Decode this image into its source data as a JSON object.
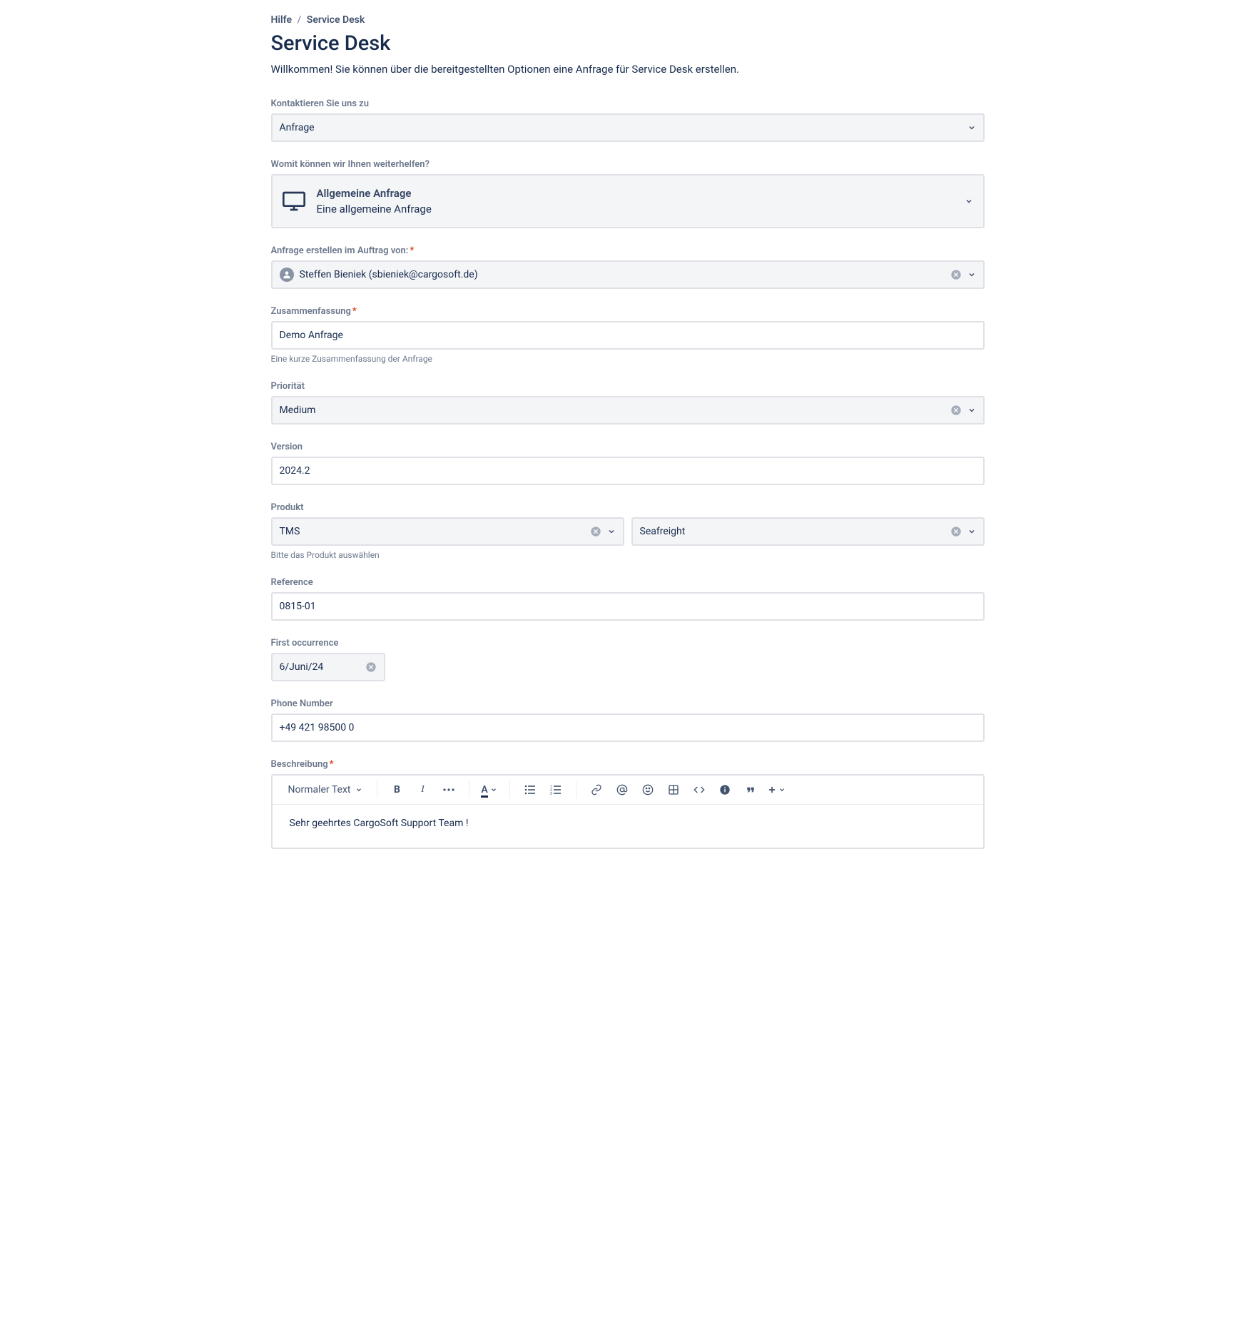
{
  "breadcrumb": {
    "root": "Hilfe",
    "current": "Service Desk"
  },
  "page_title": "Service Desk",
  "welcome": "Willkommen! Sie können über die bereitgestellten Optionen eine Anfrage für Service Desk erstellen.",
  "fields": {
    "contact_about": {
      "label": "Kontaktieren Sie uns zu",
      "value": "Anfrage"
    },
    "help_with": {
      "label": "Womit können wir Ihnen weiterhelfen?",
      "title": "Allgemeine Anfrage",
      "subtitle": "Eine allgemeine Anfrage"
    },
    "on_behalf": {
      "label": "Anfrage erstellen im Auftrag von:",
      "value": "Steffen Bieniek (sbieniek@cargosoft.de)"
    },
    "summary": {
      "label": "Zusammenfassung",
      "value": "Demo Anfrage",
      "help": "Eine kurze Zusammenfassung der Anfrage"
    },
    "priority": {
      "label": "Priorität",
      "value": "Medium"
    },
    "version": {
      "label": "Version",
      "value": "2024.2"
    },
    "product": {
      "label": "Produkt",
      "value1": "TMS",
      "value2": "Seafreight",
      "help": "Bitte das Produkt auswählen"
    },
    "reference": {
      "label": "Reference",
      "value": "0815-01"
    },
    "first_occurrence": {
      "label": "First occurrence",
      "value": "6/Juni/24"
    },
    "phone": {
      "label": "Phone Number",
      "value": "+49 421 98500 0"
    },
    "description": {
      "label": "Beschreibung",
      "style_label": "Normaler Text",
      "content": "Sehr geehrtes CargoSoft Support Team !"
    }
  }
}
